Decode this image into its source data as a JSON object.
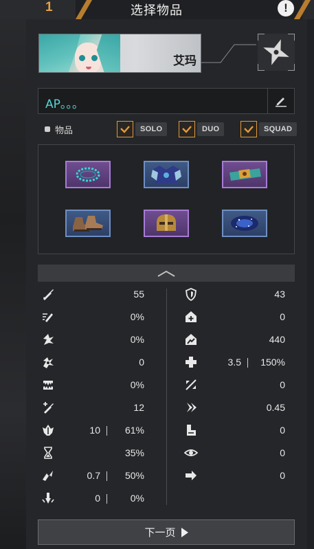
{
  "header": {
    "page_number": "1",
    "title": "选择物品",
    "accent_color": "#e5a048"
  },
  "character": {
    "name": "艾玛",
    "portrait_icon": "character-portrait",
    "weapon_icon": "shuriken-icon"
  },
  "note": {
    "value": "AP。。。",
    "edit_icon": "pencil-icon"
  },
  "filter": {
    "items_label": "物品",
    "modes": [
      {
        "label": "SOLO",
        "checked": true
      },
      {
        "label": "DUO",
        "checked": true
      },
      {
        "label": "SQUAD",
        "checked": true
      }
    ]
  },
  "items": [
    {
      "icon": "ring-icon",
      "rarity": "epic"
    },
    {
      "icon": "chest-armor-icon",
      "rarity": "rare"
    },
    {
      "icon": "bracelet-icon",
      "rarity": "epic"
    },
    {
      "icon": "boots-icon",
      "rarity": "rare"
    },
    {
      "icon": "helmet-icon",
      "rarity": "epic"
    },
    {
      "icon": "galaxy-orb-icon",
      "rarity": "rare"
    }
  ],
  "stats_left": [
    {
      "icon": "attack-power-icon",
      "value": "55"
    },
    {
      "icon": "attack-speed-icon",
      "value": "0%"
    },
    {
      "icon": "critical-chance-icon",
      "value": "0%"
    },
    {
      "icon": "critical-damage-icon",
      "value": "0"
    },
    {
      "icon": "life-steal-icon",
      "value": "0%"
    },
    {
      "icon": "extra-damage-icon",
      "value": "12"
    },
    {
      "icon": "skill-amp-icon",
      "value_a": "10",
      "value_b": "61%"
    },
    {
      "icon": "cooldown-icon",
      "value": "35%"
    },
    {
      "icon": "armor-pen-icon",
      "value_a": "0.7",
      "value_b": "50%"
    },
    {
      "icon": "skill-pen-icon",
      "value_a": "0",
      "value_b": "0%"
    }
  ],
  "stats_right": [
    {
      "icon": "defense-icon",
      "value": "43"
    },
    {
      "icon": "max-hp-icon",
      "value": "0"
    },
    {
      "icon": "max-sp-icon",
      "value": "440"
    },
    {
      "icon": "hp-regen-icon",
      "value_a": "3.5",
      "value_b": "150%"
    },
    {
      "icon": "sp-regen-icon",
      "value": "0"
    },
    {
      "icon": "vision-range-icon",
      "value": "0.45"
    },
    {
      "icon": "movement-speed-icon",
      "value": "0"
    },
    {
      "icon": "eye-icon",
      "value": "0"
    },
    {
      "icon": "arrow-right-icon",
      "value": "0"
    }
  ],
  "next_button": {
    "label": "下一页"
  }
}
